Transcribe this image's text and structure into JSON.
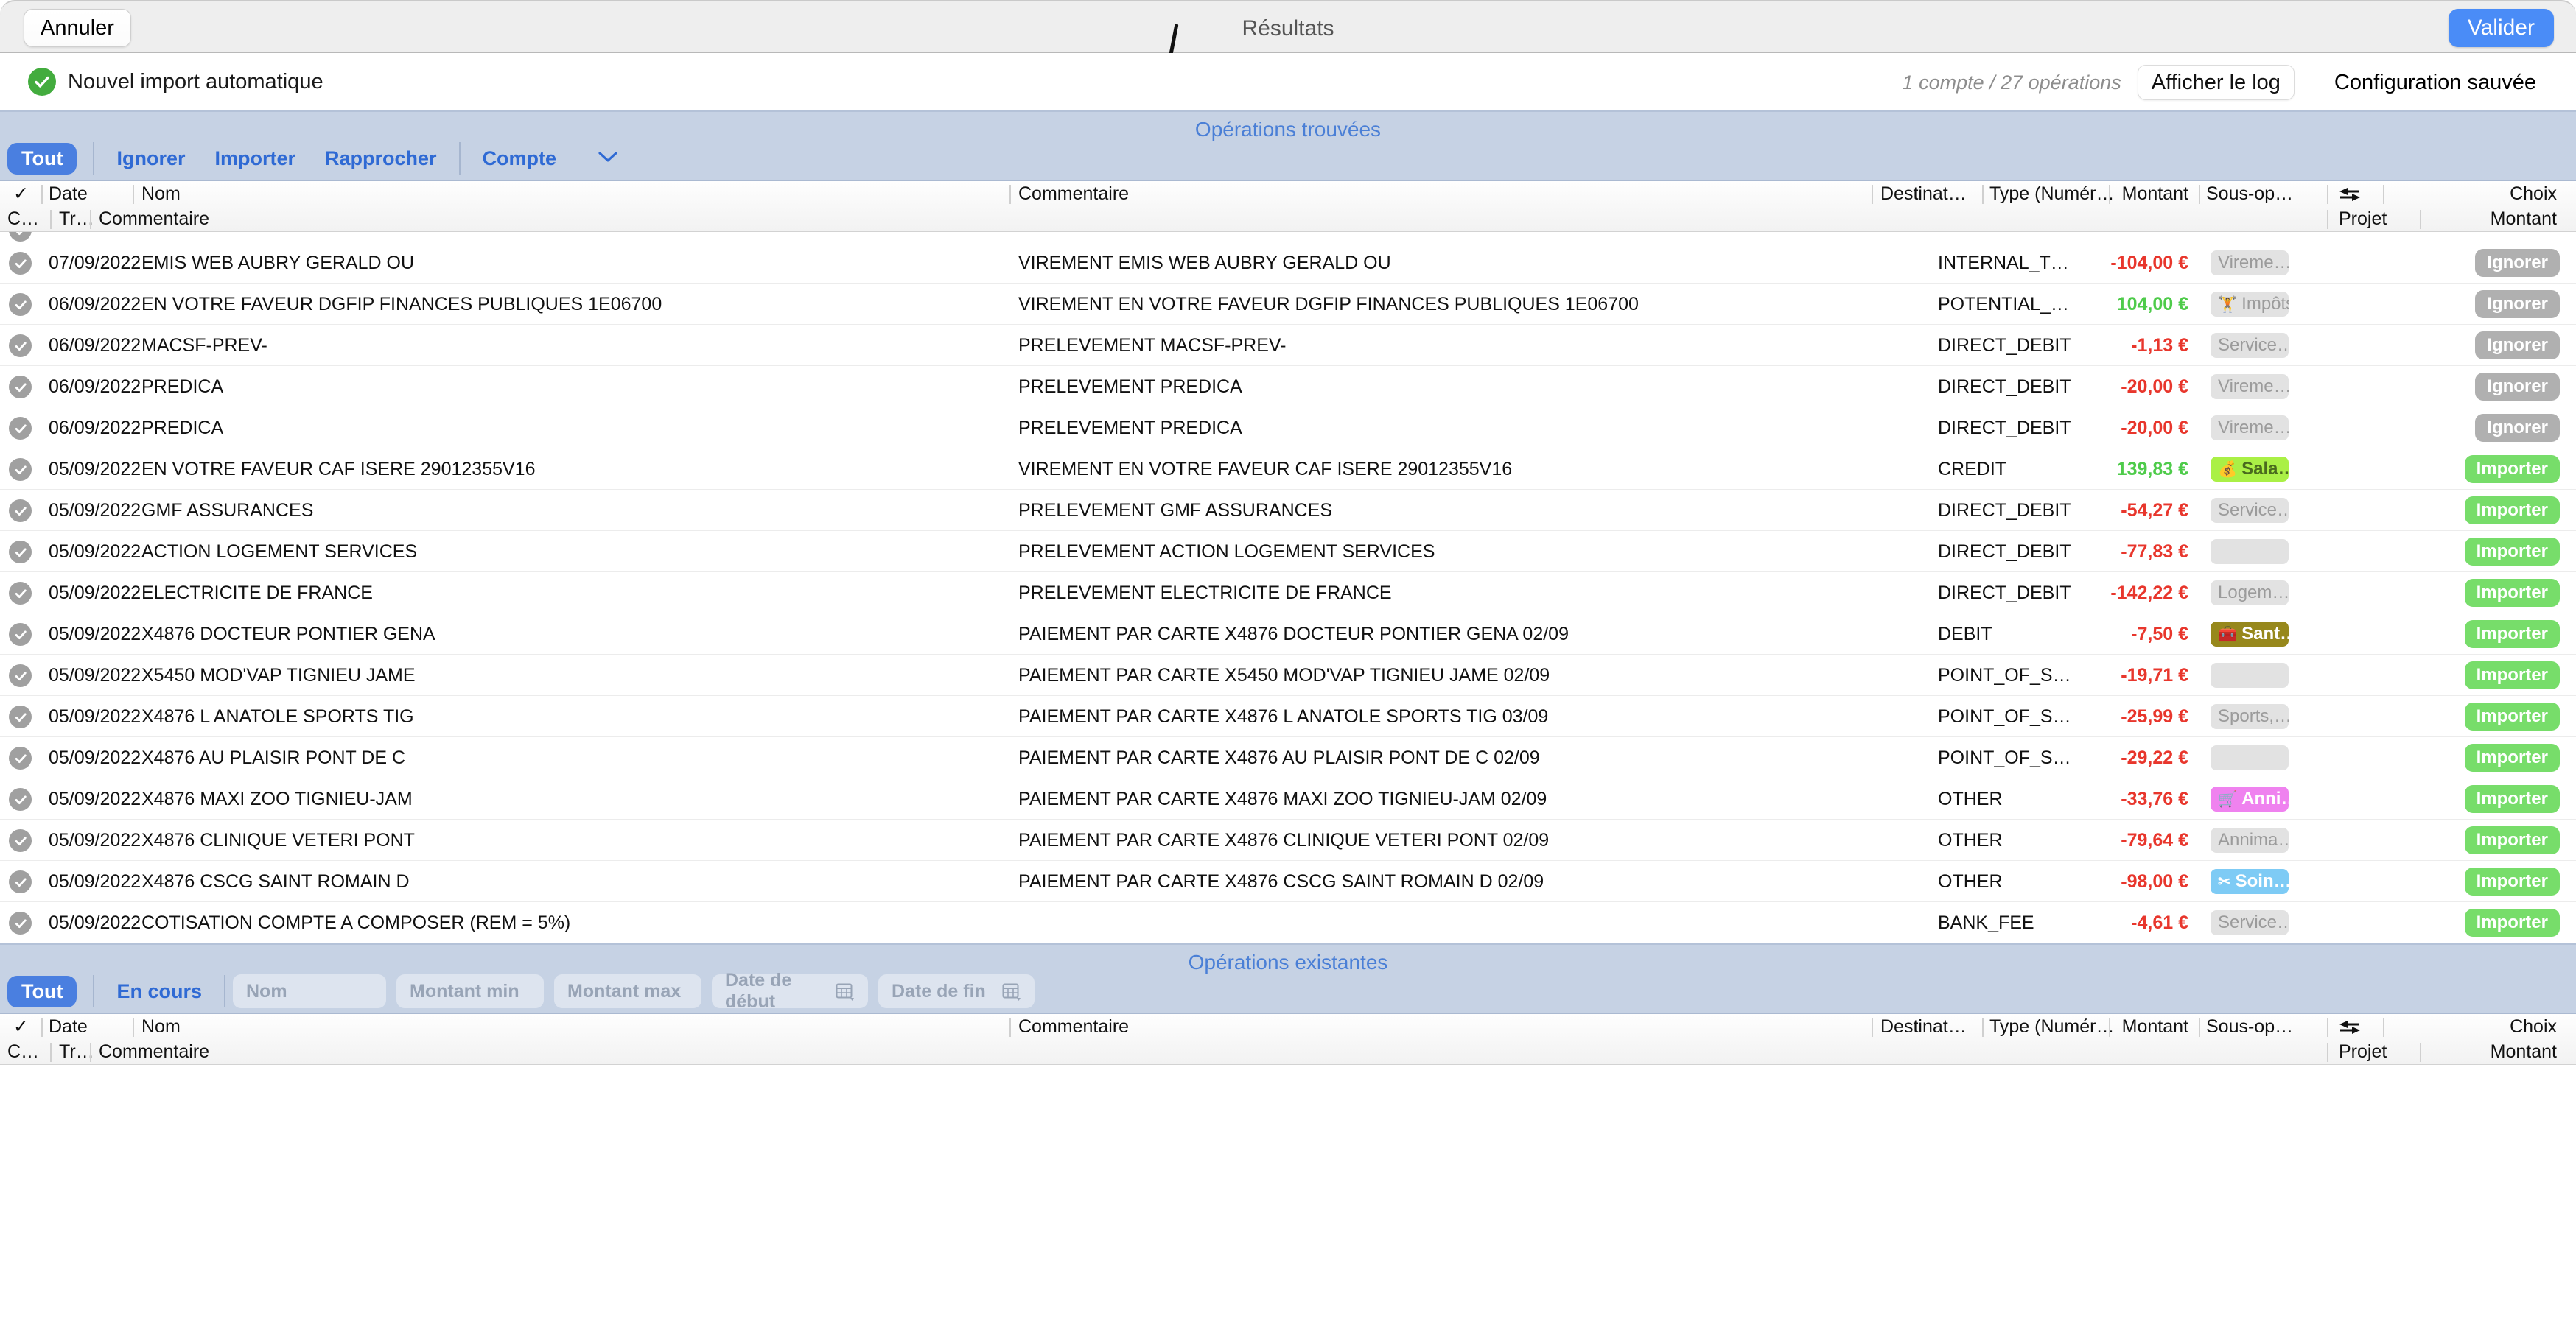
{
  "titlebar": {
    "cancel_label": "Annuler",
    "title": "Résultats",
    "validate_label": "Valider"
  },
  "infobar": {
    "status_label": "Nouvel import automatique",
    "op_count": "1 compte / 27 opérations",
    "log_button_label": "Afficher le log",
    "config_label": "Configuration sauvée"
  },
  "found_section": {
    "title": "Opérations trouvées",
    "filters": {
      "all_label": "Tout",
      "ignore_label": "Ignorer",
      "import_label": "Importer",
      "reconcile_label": "Rapprocher",
      "account_label": "Compte",
      "chevron": "chevron-down-icon"
    },
    "headers_row1": {
      "check": "✓",
      "date": "Date",
      "name": "Nom",
      "comment": "Commentaire",
      "dest": "Destinat…",
      "type": "Type (Numér…",
      "amount": "Montant",
      "subop": "Sous-op…",
      "transfer_icon": "transfer-arrows-icon",
      "choice": "Choix"
    },
    "headers_row2": {
      "c": "C…",
      "tr": "Tr…",
      "comment": "Commentaire",
      "project": "Projet",
      "amount": "Montant"
    },
    "rows": [
      {
        "date": "07/09/2022",
        "name": "EMIS WEB AUBRY GERALD OU",
        "comment": "VIREMENT EMIS WEB AUBRY GERALD OU",
        "type": "INTERNAL_T…",
        "amount": "-104,00 €",
        "amount_sign": "neg",
        "subop": "Vireme…",
        "subop_style": "grey",
        "subop_icon": "",
        "choice": "Ignorer",
        "choice_style": "ignorer"
      },
      {
        "date": "06/09/2022",
        "name": "EN VOTRE FAVEUR DGFIP FINANCES PUBLIQUES 1E06700",
        "comment": "VIREMENT EN VOTRE FAVEUR DGFIP FINANCES PUBLIQUES 1E06700",
        "type": "POTENTIAL_…",
        "amount": "104,00 €",
        "amount_sign": "pos",
        "subop": "Impôts",
        "subop_style": "grey",
        "subop_icon": "🏋",
        "choice": "Ignorer",
        "choice_style": "ignorer"
      },
      {
        "date": "06/09/2022",
        "name": "MACSF-PREV-",
        "comment": "PRELEVEMENT MACSF-PREV-",
        "type": "DIRECT_DEBIT",
        "amount": "-1,13 €",
        "amount_sign": "neg",
        "subop": "Service…",
        "subop_style": "grey",
        "subop_icon": "",
        "choice": "Ignorer",
        "choice_style": "ignorer"
      },
      {
        "date": "06/09/2022",
        "name": "PREDICA",
        "comment": "PRELEVEMENT PREDICA",
        "type": "DIRECT_DEBIT",
        "amount": "-20,00 €",
        "amount_sign": "neg",
        "subop": "Vireme…",
        "subop_style": "grey",
        "subop_icon": "",
        "choice": "Ignorer",
        "choice_style": "ignorer"
      },
      {
        "date": "06/09/2022",
        "name": "PREDICA",
        "comment": "PRELEVEMENT PREDICA",
        "type": "DIRECT_DEBIT",
        "amount": "-20,00 €",
        "amount_sign": "neg",
        "subop": "Vireme…",
        "subop_style": "grey",
        "subop_icon": "",
        "choice": "Ignorer",
        "choice_style": "ignorer"
      },
      {
        "date": "05/09/2022",
        "name": "EN VOTRE FAVEUR CAF ISERE 29012355V16",
        "comment": "VIREMENT EN VOTRE FAVEUR CAF ISERE 29012355V16",
        "type": "CREDIT",
        "amount": "139,83 €",
        "amount_sign": "pos",
        "subop": "Sala…",
        "subop_style": "color",
        "subop_bg": "#aaf046",
        "subop_fg": "#4a6b1e",
        "subop_icon": "💰",
        "choice": "Importer",
        "choice_style": "importer"
      },
      {
        "date": "05/09/2022",
        "name": "GMF ASSURANCES",
        "comment": "PRELEVEMENT GMF ASSURANCES",
        "type": "DIRECT_DEBIT",
        "amount": "-54,27 €",
        "amount_sign": "neg",
        "subop": "Service…",
        "subop_style": "grey",
        "subop_icon": "",
        "choice": "Importer",
        "choice_style": "importer"
      },
      {
        "date": "05/09/2022",
        "name": "ACTION LOGEMENT SERVICES",
        "comment": "PRELEVEMENT ACTION LOGEMENT SERVICES",
        "type": "DIRECT_DEBIT",
        "amount": "-77,83 €",
        "amount_sign": "neg",
        "subop": "",
        "subop_style": "empty",
        "subop_icon": "",
        "choice": "Importer",
        "choice_style": "importer"
      },
      {
        "date": "05/09/2022",
        "name": "ELECTRICITE DE FRANCE",
        "comment": "PRELEVEMENT ELECTRICITE DE FRANCE",
        "type": "DIRECT_DEBIT",
        "amount": "-142,22 €",
        "amount_sign": "neg",
        "subop": "Logem…",
        "subop_style": "grey",
        "subop_icon": "",
        "choice": "Importer",
        "choice_style": "importer"
      },
      {
        "date": "05/09/2022",
        "name": "X4876 DOCTEUR PONTIER GENA",
        "comment": "PAIEMENT PAR CARTE X4876 DOCTEUR PONTIER GENA 02/09",
        "type": "DEBIT",
        "amount": "-7,50 €",
        "amount_sign": "neg",
        "subop": "Sant…",
        "subop_style": "color",
        "subop_bg": "#97881c",
        "subop_fg": "#ffffff",
        "subop_icon": "🧰",
        "choice": "Importer",
        "choice_style": "importer"
      },
      {
        "date": "05/09/2022",
        "name": "X5450 MOD'VAP TIGNIEU JAME",
        "comment": "PAIEMENT PAR CARTE X5450 MOD'VAP TIGNIEU JAME 02/09",
        "type": "POINT_OF_S…",
        "amount": "-19,71 €",
        "amount_sign": "neg",
        "subop": "",
        "subop_style": "empty",
        "subop_icon": "",
        "choice": "Importer",
        "choice_style": "importer"
      },
      {
        "date": "05/09/2022",
        "name": "X4876 L ANATOLE SPORTS TIG",
        "comment": "PAIEMENT PAR CARTE X4876 L ANATOLE SPORTS TIG 03/09",
        "type": "POINT_OF_S…",
        "amount": "-25,99 €",
        "amount_sign": "neg",
        "subop": "Sports,…",
        "subop_style": "grey",
        "subop_icon": "",
        "choice": "Importer",
        "choice_style": "importer"
      },
      {
        "date": "05/09/2022",
        "name": "X4876 AU PLAISIR PONT DE C",
        "comment": "PAIEMENT PAR CARTE X4876 AU PLAISIR PONT DE C 02/09",
        "type": "POINT_OF_S…",
        "amount": "-29,22 €",
        "amount_sign": "neg",
        "subop": "",
        "subop_style": "empty",
        "subop_icon": "",
        "choice": "Importer",
        "choice_style": "importer"
      },
      {
        "date": "05/09/2022",
        "name": "X4876 MAXI ZOO TIGNIEU-JAM",
        "comment": "PAIEMENT PAR CARTE X4876 MAXI ZOO TIGNIEU-JAM 02/09",
        "type": "OTHER",
        "amount": "-33,76 €",
        "amount_sign": "neg",
        "subop": "Anni…",
        "subop_style": "color",
        "subop_bg": "#ef82ef",
        "subop_fg": "#ffffff",
        "subop_icon": "🛒",
        "choice": "Importer",
        "choice_style": "importer"
      },
      {
        "date": "05/09/2022",
        "name": "X4876 CLINIQUE VETERI PONT",
        "comment": "PAIEMENT PAR CARTE X4876 CLINIQUE VETERI PONT 02/09",
        "type": "OTHER",
        "amount": "-79,64 €",
        "amount_sign": "neg",
        "subop": "Annima…",
        "subop_style": "grey",
        "subop_icon": "",
        "choice": "Importer",
        "choice_style": "importer"
      },
      {
        "date": "05/09/2022",
        "name": "X4876 CSCG SAINT ROMAIN D",
        "comment": "PAIEMENT PAR CARTE X4876 CSCG SAINT ROMAIN D 02/09",
        "type": "OTHER",
        "amount": "-98,00 €",
        "amount_sign": "neg",
        "subop": "Soin…",
        "subop_style": "color",
        "subop_bg": "#7ecbf5",
        "subop_fg": "#ffffff",
        "subop_icon": "✂",
        "choice": "Importer",
        "choice_style": "importer"
      },
      {
        "date": "05/09/2022",
        "name": "COTISATION COMPTE A COMPOSER (REM = 5%)",
        "comment": "",
        "type": "BANK_FEE",
        "amount": "-4,61 €",
        "amount_sign": "neg",
        "subop": "Service…",
        "subop_style": "grey",
        "subop_icon": "",
        "choice": "Importer",
        "choice_style": "importer"
      }
    ]
  },
  "existing_section": {
    "title": "Opérations existantes",
    "filters": {
      "all_label": "Tout",
      "pending_label": "En cours",
      "name_placeholder": "Nom",
      "min_placeholder": "Montant min",
      "max_placeholder": "Montant max",
      "start_placeholder": "Date de début",
      "end_placeholder": "Date de fin",
      "calendar_icon": "calendar-icon"
    },
    "headers_row1": {
      "check": "✓",
      "date": "Date",
      "name": "Nom",
      "comment": "Commentaire",
      "dest": "Destinat…",
      "type": "Type (Numér…",
      "amount": "Montant",
      "subop": "Sous-op…",
      "transfer_icon": "transfer-arrows-icon",
      "choice": "Choix"
    },
    "headers_row2": {
      "c": "C…",
      "tr": "Tr…",
      "comment": "Commentaire",
      "project": "Projet",
      "amount": "Montant"
    }
  },
  "colors": {
    "accent_blue": "#4a7fe0",
    "section_bg": "#c6d2e4",
    "negative": "#e8362c",
    "positive": "#4ecb4a",
    "importer_green": "#77dd6a",
    "ignorer_grey": "#b0b0b0"
  }
}
